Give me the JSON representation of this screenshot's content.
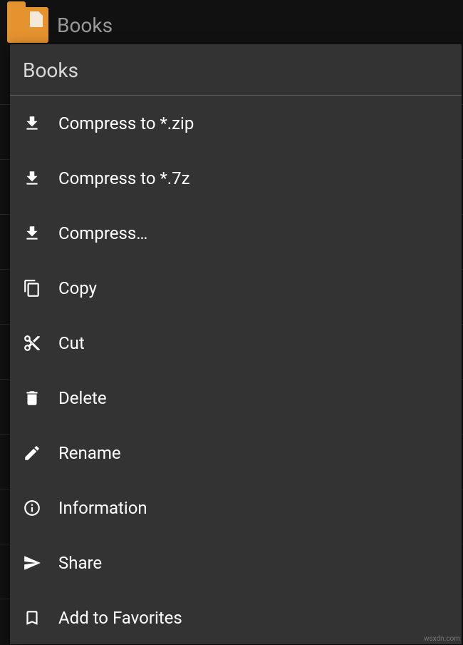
{
  "header": {
    "folder_label": "Books"
  },
  "popup": {
    "title": "Books",
    "items": [
      {
        "icon": "download",
        "label": "Compress to *.zip"
      },
      {
        "icon": "download",
        "label": "Compress to *.7z"
      },
      {
        "icon": "download",
        "label": "Compress…"
      },
      {
        "icon": "copy",
        "label": "Copy"
      },
      {
        "icon": "cut",
        "label": "Cut"
      },
      {
        "icon": "delete",
        "label": "Delete"
      },
      {
        "icon": "rename",
        "label": "Rename"
      },
      {
        "icon": "info",
        "label": "Information"
      },
      {
        "icon": "share",
        "label": "Share"
      },
      {
        "icon": "bookmark",
        "label": "Add to Favorites"
      }
    ]
  },
  "watermark": "wsxdn.com"
}
